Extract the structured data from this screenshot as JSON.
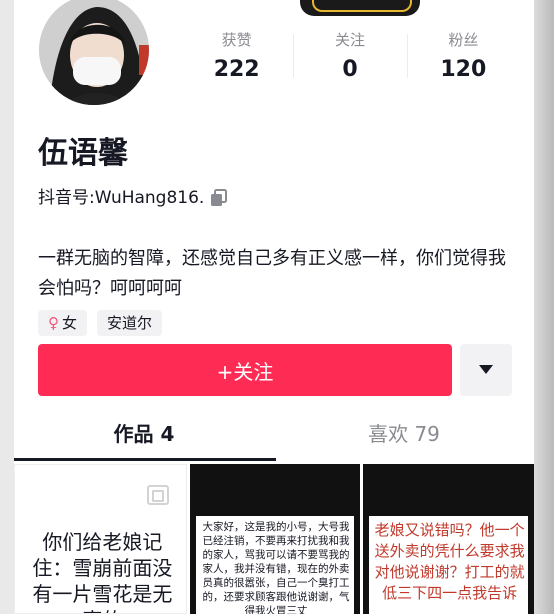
{
  "profile": {
    "name": "伍语馨",
    "douyin_id_label": "抖音号: ",
    "douyin_id": "WuHang816.",
    "bio": "一群无脑的智障，还感觉自己多有正义感一样，你们觉得我会怕吗？呵呵呵呵",
    "tags": {
      "gender": "女",
      "location": "安道尔"
    }
  },
  "stats": [
    {
      "label": "获赞",
      "value": "222"
    },
    {
      "label": "关注",
      "value": "0"
    },
    {
      "label": "粉丝",
      "value": "120"
    }
  ],
  "actions": {
    "follow": "+关注"
  },
  "tabs": [
    {
      "label": "作品 4"
    },
    {
      "label": "喜欢 79"
    }
  ],
  "videos": [
    {
      "text": "你们给老娘记住：雪崩前面没有一片雪花是无辜的"
    },
    {
      "text": "大家好，这是我的小号，大号我已经注销，不要再来打扰我和我的家人，骂我可以请不要骂我的家人，我并没有错，现在的外卖员真的很嚣张，自己一个臭打工的，还要求顾客跟他说谢谢，气得我火冒三丈"
    },
    {
      "text": "老娘又说错吗？他一个送外卖的凭什么要求我对他说谢谢？打工的就低三下四一点我告诉"
    }
  ],
  "colors": {
    "accent": "#fe2c55",
    "text": "#161823",
    "muted": "#8a8b91"
  }
}
